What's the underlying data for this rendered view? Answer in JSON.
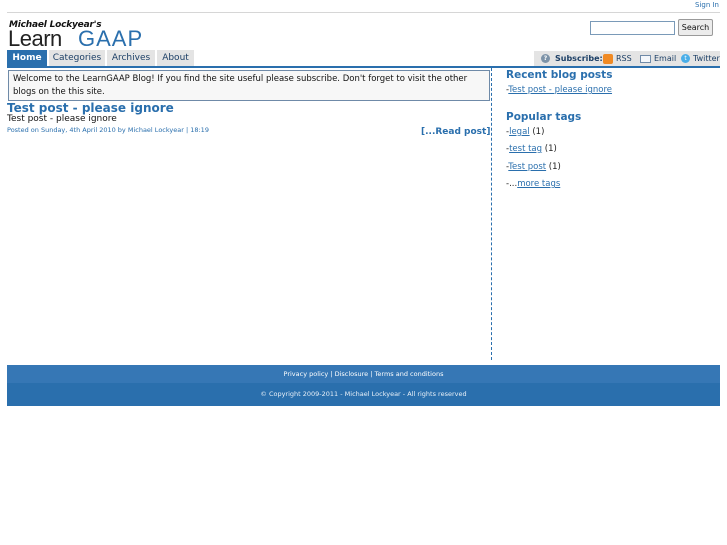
{
  "header": {
    "sign_in": "Sign In",
    "logo_author": "Michael Lockyear's",
    "logo_learn": "Learn",
    "logo_gaap": "GAAP",
    "search_placeholder": "",
    "search_button": "Search"
  },
  "nav": {
    "tabs": [
      {
        "label": "Home",
        "active": true
      },
      {
        "label": "Categories",
        "active": false
      },
      {
        "label": "Archives",
        "active": false
      },
      {
        "label": "About",
        "active": false
      }
    ]
  },
  "subscribe": {
    "label": "Subscribe:",
    "rss": "RSS",
    "email": "Email",
    "twitter": "Twitter"
  },
  "welcome": "Welcome to the LearnGAAP Blog! If you find the site useful please subscribe. Don't forget to visit the other blogs on the this site.",
  "post": {
    "title": "Test post - please ignore",
    "excerpt": "Test post - please ignore",
    "meta": "Posted on Sunday, 4th April 2010 by Michael Lockyear | 18:19",
    "read_more": "[...Read post]"
  },
  "sidebar": {
    "recent_heading": "Recent blog posts",
    "recent_posts": [
      {
        "prefix": "-",
        "label": "Test post - please ignore"
      }
    ],
    "tags_heading": "Popular tags",
    "tags": [
      {
        "prefix": "-",
        "label": "legal",
        "count": " (1)"
      },
      {
        "prefix": "-",
        "label": "test tag",
        "count": " (1)"
      },
      {
        "prefix": "-",
        "label": "Test post",
        "count": " (1)"
      }
    ],
    "more_prefix": "-...",
    "more_tags": "more tags"
  },
  "footer": {
    "privacy": "Privacy policy",
    "sep": " | ",
    "disclosure": "Disclosure",
    "terms": "Terms and conditions",
    "copyright": "© Copyright 2009-2011 - Michael Lockyear - All rights reserved"
  },
  "colors": {
    "brand_blue": "#2a6fad",
    "nav_grey": "#e4e4e4"
  }
}
